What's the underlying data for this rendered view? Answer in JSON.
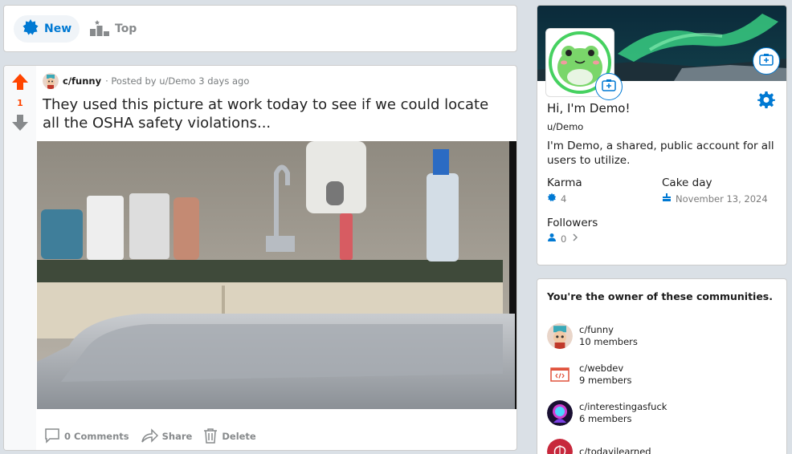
{
  "sort": {
    "new_label": "New",
    "top_label": "Top"
  },
  "post": {
    "score": "1",
    "community": "c/funny",
    "posted_by": "· Posted by u/Demo 3 days ago",
    "title": "They used this picture at work today to see if we could locate all the OSHA safety violations...",
    "actions": {
      "comments": "0 Comments",
      "share": "Share",
      "delete": "Delete"
    }
  },
  "profile": {
    "greeting": "Hi, I'm Demo!",
    "username": "u/Demo",
    "bio": "I'm Demo, a shared, public account for all users to utilize.",
    "karma_label": "Karma",
    "karma_value": "4",
    "cakeday_label": "Cake day",
    "cakeday_value": "November 13, 2024",
    "followers_label": "Followers",
    "followers_value": "0"
  },
  "communities": {
    "title": "You're the owner of these communities.",
    "items": [
      {
        "name": "c/funny",
        "members": "10 members"
      },
      {
        "name": "c/webdev",
        "members": "9 members"
      },
      {
        "name": "c/interestingasfuck",
        "members": "6 members"
      },
      {
        "name": "c/todayilearned",
        "members": ""
      }
    ]
  },
  "colors": {
    "accent": "#0079d3",
    "upvote": "#ff4500",
    "background": "#dae0e6"
  }
}
